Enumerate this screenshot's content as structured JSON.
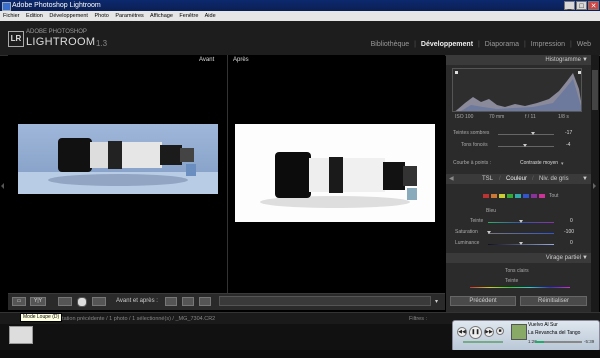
{
  "titlebar": {
    "title": "Adobe Photoshop Lightroom",
    "min": "_",
    "max": "□",
    "close": "✕"
  },
  "menu": [
    "Fichier",
    "Edition",
    "Développement",
    "Photo",
    "Paramètres",
    "Affichage",
    "Fenêtre",
    "Aide"
  ],
  "identity": {
    "logo": "LR",
    "line1": "ADOBE PHOTOSHOP",
    "line2": "LIGHTROOM",
    "version": "1.3"
  },
  "modules": {
    "items": [
      "Bibliothèque",
      "Développement",
      "Diaporama",
      "Impression",
      "Web"
    ],
    "active_index": 1,
    "separator": "|"
  },
  "view": {
    "before_label": "Avant",
    "after_label": "Après"
  },
  "toolbar": {
    "label": "Avant et après :",
    "view_btn": "▭",
    "yy_btn": "Y|Y",
    "menu_arrow": "▾"
  },
  "tooltip": "Mode Loupe (D)",
  "filmstrip": {
    "breadcrumb": "Importation précédente / 1 photo / 1 sélectionné(s) / _MG_7304.CR2",
    "filter_label": "Filtres :"
  },
  "panels": {
    "histogram": {
      "title": "Histogramme",
      "iso": "ISO 100",
      "focal": "70 mm",
      "aperture": "f / 11",
      "shutter": "1/8 s"
    },
    "tone": {
      "sliders": [
        {
          "label": "Teintes sombres",
          "value": "-17",
          "pos": 0.62
        },
        {
          "label": "Tons foncés",
          "value": "-4",
          "pos": 0.48
        }
      ],
      "curve_label": "Courbe à points :",
      "curve_value": "Contraste moyen"
    },
    "hsl": {
      "tabs": [
        "TSL",
        "Couleur",
        "Niv. de gris"
      ],
      "active_tab": 1,
      "all_label": "Tout",
      "swatch_colors": [
        "#b33",
        "#c73",
        "#cc3",
        "#3a3",
        "#3aa",
        "#35c",
        "#839",
        "#c39"
      ],
      "group_label": "Bleu",
      "sliders": [
        {
          "label": "Teinte",
          "value": "0",
          "pos": 0.5
        },
        {
          "label": "Saturation",
          "value": "-100",
          "pos": 0.02
        },
        {
          "label": "Luminance",
          "value": "0",
          "pos": 0.5
        }
      ]
    },
    "split": {
      "title": "Virage partiel",
      "group_label": "Tons clairs",
      "slider_label": "Teinte"
    },
    "buttons": {
      "previous": "Précédent",
      "reset": "Réinitialiser"
    }
  },
  "media": {
    "title": "Vuelvo Al Sur",
    "album": "La Revancha del Tango",
    "elapsed": "1:20",
    "remaining": "-5:39",
    "progress": 0.2
  }
}
